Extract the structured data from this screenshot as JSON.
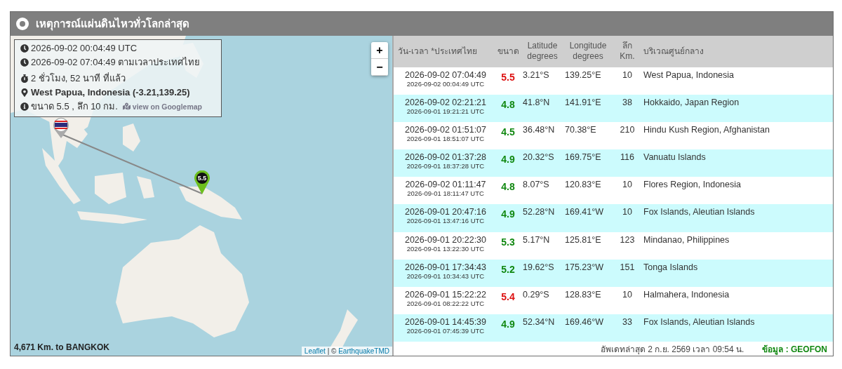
{
  "header": {
    "title": "เหตุการณ์แผ่นดินไหวทั่วโลกล่าสุด"
  },
  "map": {
    "info": {
      "utc_time": "2026-09-02 00:04:49 UTC",
      "thai_time": "2026-09-02 07:04:49 ตามเวลาประเทศไทย",
      "elapsed": "2 ชั่วโมง, 52 นาที ที่แล้ว",
      "location": "West Papua, Indonesia (-3.21,139.25)",
      "summary": "ขนาด 5.5 , ลึก 10 กม.",
      "map_link": "view on Googlemap"
    },
    "zoom_in": "+",
    "zoom_out": "−",
    "marker_label": "5.5",
    "distance": "4,671 Km. to BANGKOK",
    "attribution": {
      "first_link": "Leaflet",
      "separator": "| ©",
      "second_link": "EarthquakeTMD"
    }
  },
  "table": {
    "columns": [
      "วัน-เวลา *ประเทศไทย",
      "ขนาด",
      "Latitude\ndegrees",
      "Longitude\ndegrees",
      "ลึก\nKm.",
      "บริเวณศูนย์กลาง"
    ],
    "rows": [
      {
        "local_time": "2026-09-02 07:04:49",
        "utc_time": "2026-09-02 00:04:49 UTC",
        "magnitude": "5.5",
        "color": "#dd1111",
        "latitude": "3.21°S",
        "longitude": "139.25°E",
        "depth": "10",
        "region": "West Papua, Indonesia"
      },
      {
        "local_time": "2026-09-02 02:21:21",
        "utc_time": "2026-09-01 19:21:21 UTC",
        "magnitude": "4.8",
        "color": "#118811",
        "latitude": "41.8°N",
        "longitude": "141.91°E",
        "depth": "38",
        "region": "Hokkaido, Japan Region"
      },
      {
        "local_time": "2026-09-02 01:51:07",
        "utc_time": "2026-09-01 18:51:07 UTC",
        "magnitude": "4.5",
        "color": "#118811",
        "latitude": "36.48°N",
        "longitude": "70.38°E",
        "depth": "210",
        "region": "Hindu Kush Region, Afghanistan"
      },
      {
        "local_time": "2026-09-02 01:37:28",
        "utc_time": "2026-09-01 18:37:28 UTC",
        "magnitude": "4.9",
        "color": "#118811",
        "latitude": "20.32°S",
        "longitude": "169.75°E",
        "depth": "116",
        "region": "Vanuatu Islands"
      },
      {
        "local_time": "2026-09-02 01:11:47",
        "utc_time": "2026-09-01 18:11:47 UTC",
        "magnitude": "4.8",
        "color": "#118811",
        "latitude": "8.07°S",
        "longitude": "120.83°E",
        "depth": "10",
        "region": "Flores Region, Indonesia"
      },
      {
        "local_time": "2026-09-01 20:47:16",
        "utc_time": "2026-09-01 13:47:16 UTC",
        "magnitude": "4.9",
        "color": "#118811",
        "latitude": "52.28°N",
        "longitude": "169.41°W",
        "depth": "10",
        "region": "Fox Islands, Aleutian Islands"
      },
      {
        "local_time": "2026-09-01 20:22:30",
        "utc_time": "2026-09-01 13:22:30 UTC",
        "magnitude": "5.3",
        "color": "#118811",
        "latitude": "5.17°N",
        "longitude": "125.81°E",
        "depth": "123",
        "region": "Mindanao, Philippines"
      },
      {
        "local_time": "2026-09-01 17:34:43",
        "utc_time": "2026-09-01 10:34:43 UTC",
        "magnitude": "5.2",
        "color": "#118811",
        "latitude": "19.62°S",
        "longitude": "175.23°W",
        "depth": "151",
        "region": "Tonga Islands"
      },
      {
        "local_time": "2026-09-01 15:22:22",
        "utc_time": "2026-09-01 08:22:22 UTC",
        "magnitude": "5.4",
        "color": "#dd1111",
        "latitude": "0.29°S",
        "longitude": "128.83°E",
        "depth": "10",
        "region": "Halmahera, Indonesia"
      },
      {
        "local_time": "2026-09-01 14:45:39",
        "utc_time": "2026-09-01 07:45:39 UTC",
        "magnitude": "4.9",
        "color": "#118811",
        "latitude": "52.34°N",
        "longitude": "169.46°W",
        "depth": "33",
        "region": "Fox Islands, Aleutian Islands"
      }
    ]
  },
  "footer": {
    "updated": "อัพเดทล่าสุด 2 ก.ย. 2569 เวลา 09:54 น.",
    "source": "ข้อมูล : GEOFON"
  }
}
